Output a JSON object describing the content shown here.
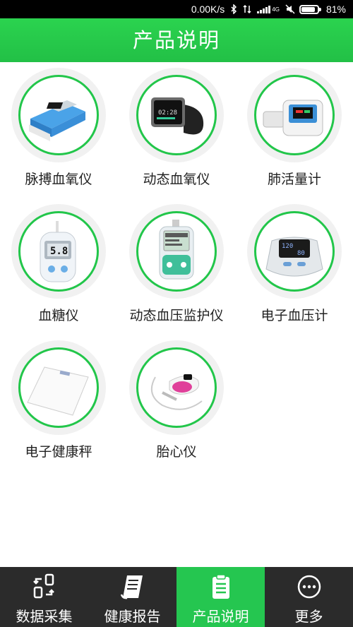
{
  "status_bar": {
    "speed": "0.00K/s",
    "signal_badge": "4G",
    "battery": "81%",
    "battery_level": 0.81
  },
  "header": {
    "title": "产品说明"
  },
  "products": [
    {
      "label": "脉搏血氧仪",
      "icon": "pulse-oximeter-icon"
    },
    {
      "label": "动态血氧仪",
      "icon": "oximeter-watch-icon"
    },
    {
      "label": "肺活量计",
      "icon": "spirometer-icon"
    },
    {
      "label": "血糖仪",
      "icon": "glucose-meter-icon"
    },
    {
      "label": "动态血压监护仪",
      "icon": "bp-monitor-icon"
    },
    {
      "label": "电子血压计",
      "icon": "blood-pressure-meter-icon"
    },
    {
      "label": "电子健康秤",
      "icon": "scale-icon"
    },
    {
      "label": "胎心仪",
      "icon": "fetal-doppler-icon"
    }
  ],
  "tabs": [
    {
      "label": "数据采集",
      "icon": "data-collect-icon",
      "active": false
    },
    {
      "label": "健康报告",
      "icon": "report-icon",
      "active": false
    },
    {
      "label": "产品说明",
      "icon": "clipboard-icon",
      "active": true
    },
    {
      "label": "更多",
      "icon": "more-icon",
      "active": false
    }
  ]
}
